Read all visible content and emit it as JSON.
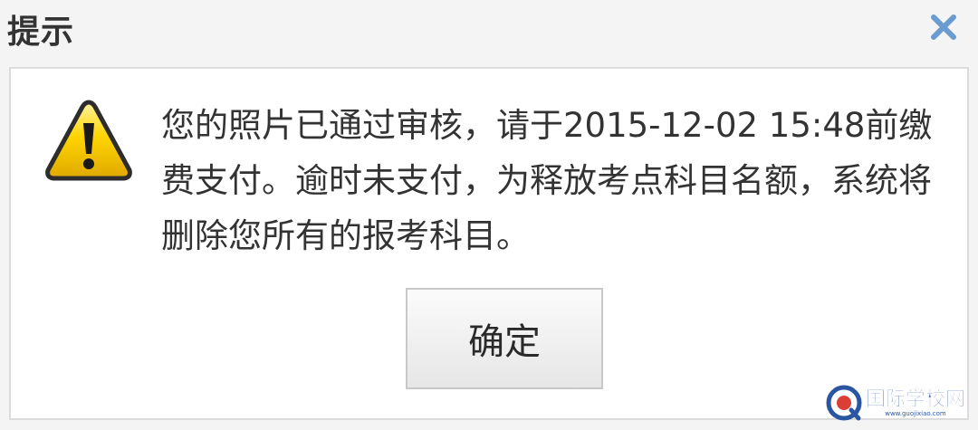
{
  "dialog": {
    "title": "提示",
    "close_icon": "close-icon",
    "warning_icon": "warning-icon",
    "message": "您的照片已通过审核，请于2015-12-02 15:48前缴费支付。逾时未支付，为释放考点科目名额，系统将删除您所有的报考科目。",
    "ok_label": "确定"
  },
  "watermark": {
    "text": "国际学校网",
    "url": "www.guojixiao.com"
  },
  "colors": {
    "title_text": "#333333",
    "close_icon": "#6a9bd1",
    "warning_fill": "#f5c400",
    "warning_border": "#2d2d2d",
    "content_bg": "#ffffff",
    "content_border": "#dcdcdc",
    "watermark": "#1f4e9c"
  }
}
